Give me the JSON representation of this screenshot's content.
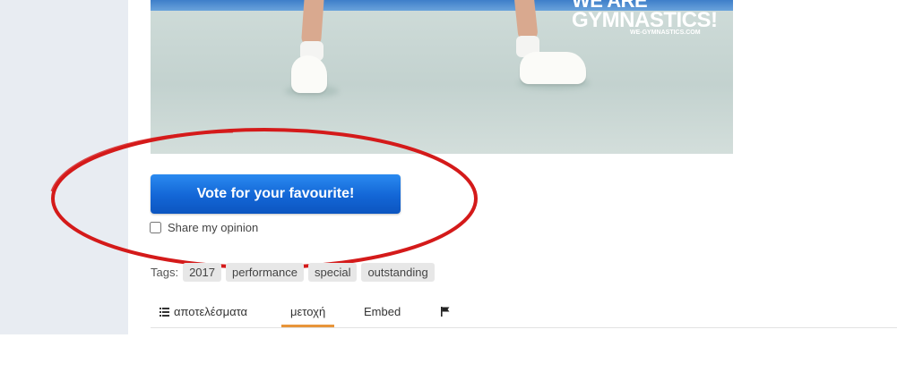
{
  "photo": {
    "logo_line1": "WE ARE",
    "logo_line2": "GYMNASTICS!",
    "logo_line3": "WE-GYMNASTICS.COM"
  },
  "vote": {
    "button_label": "Vote for your favourite!",
    "share_label": "Share my opinion",
    "share_checked": false
  },
  "tags": {
    "label": "Tags:",
    "items": [
      "2017",
      "performance",
      "special",
      "outstanding"
    ]
  },
  "tabs": [
    {
      "label": "αποτελέσματα",
      "icon": "list-icon",
      "active": false
    },
    {
      "label": "μετοχή",
      "active": true
    },
    {
      "label": "Embed",
      "active": false
    },
    {
      "label": "",
      "icon": "flag-icon",
      "active": false
    }
  ],
  "colors": {
    "button_blue": "#1366d6",
    "annotation_red": "#d41a1a",
    "active_tab_underline": "#e8953a",
    "sidebar_bg": "#e8ecf2"
  }
}
